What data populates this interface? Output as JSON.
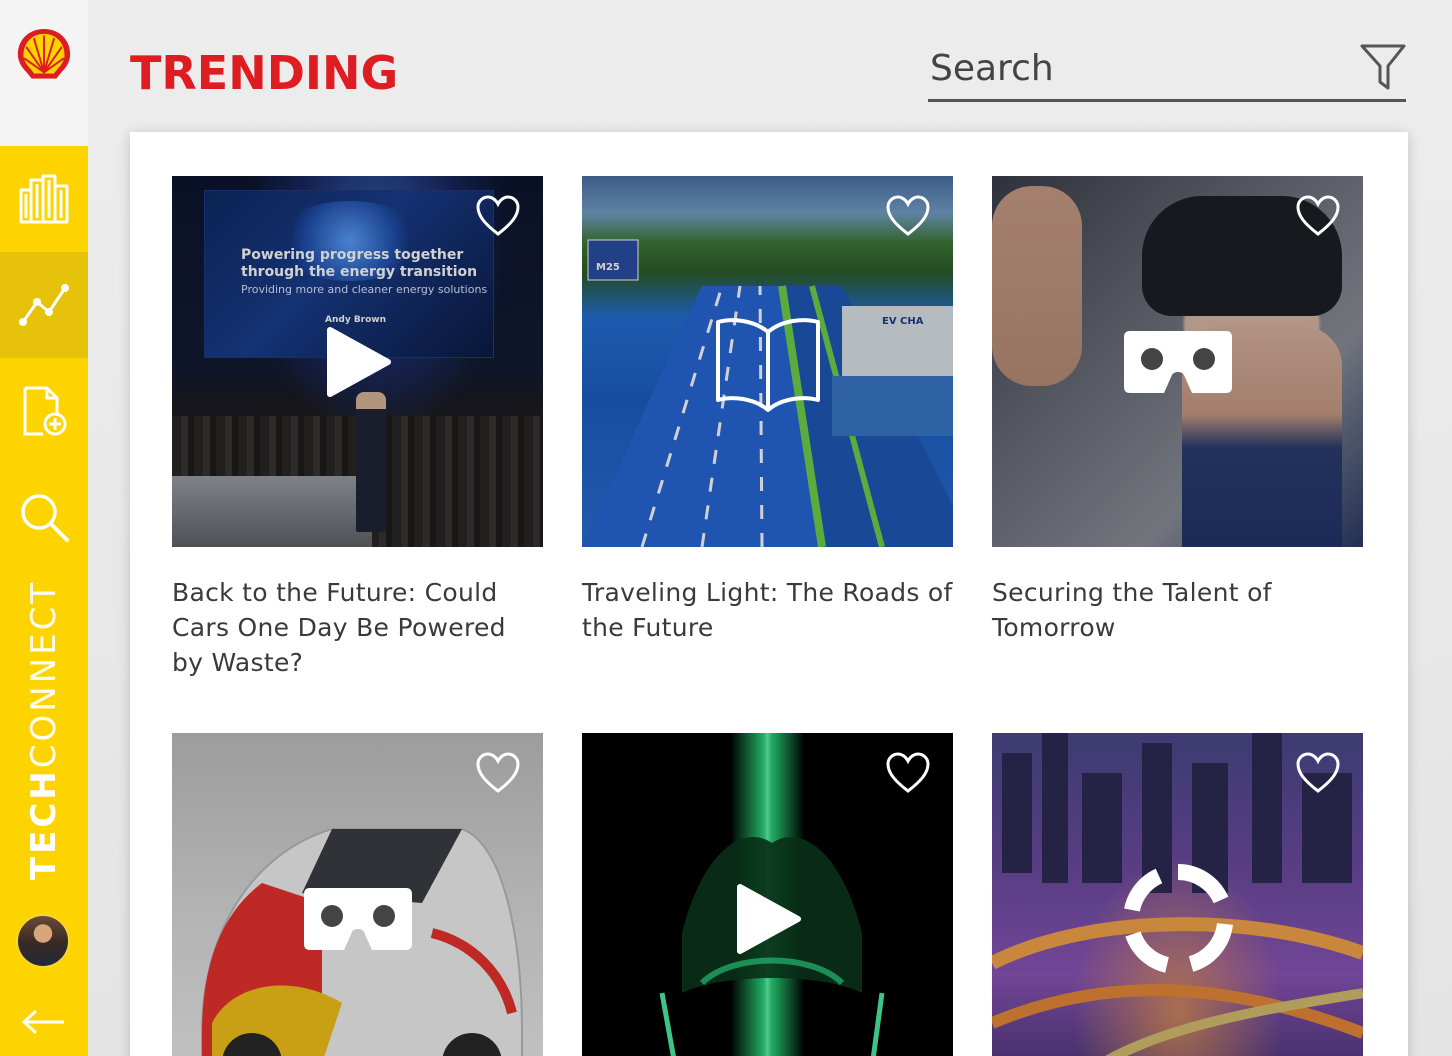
{
  "app": {
    "brand_bold": "TECH",
    "brand_light": "CONNECT",
    "colors": {
      "accent_red": "#dd1d21",
      "sidebar_yellow": "#fdd400"
    }
  },
  "sidebar": {
    "logo_icon": "shell-logo",
    "items": [
      {
        "icon": "buildings-icon",
        "active": false
      },
      {
        "icon": "trend-line-icon",
        "active": true
      },
      {
        "icon": "add-document-icon",
        "active": false
      },
      {
        "icon": "search-icon",
        "active": false
      }
    ],
    "avatar_icon": "user-avatar",
    "back_icon": "back-arrow-icon"
  },
  "header": {
    "title": "TRENDING",
    "search": {
      "placeholder": "Search",
      "value": ""
    },
    "filter_icon": "filter-icon"
  },
  "cards": [
    {
      "title": "Back to the Future: Could Cars One Day Be Powered by Waste?",
      "type_icon": "play-icon",
      "favorite_icon": "heart-icon",
      "image_text": {
        "headline_1": "Powering progress together",
        "headline_2": "through the energy transition",
        "sub": "Providing more and cleaner energy solutions",
        "speaker": "Andy Brown"
      }
    },
    {
      "title": "Traveling Light: The Roads of the Future",
      "type_icon": "book-icon",
      "favorite_icon": "heart-icon",
      "image_text": {
        "sign": "M25",
        "ev": "EV CHA"
      }
    },
    {
      "title": "Securing the Talent of Tomorrow",
      "type_icon": "vr-headset-icon",
      "favorite_icon": "heart-icon"
    },
    {
      "title": "",
      "type_icon": "vr-headset-icon",
      "favorite_icon": "heart-icon"
    },
    {
      "title": "",
      "type_icon": "play-icon",
      "favorite_icon": "heart-icon"
    },
    {
      "title": "",
      "type_icon": "360-view-icon",
      "favorite_icon": "heart-icon"
    }
  ]
}
